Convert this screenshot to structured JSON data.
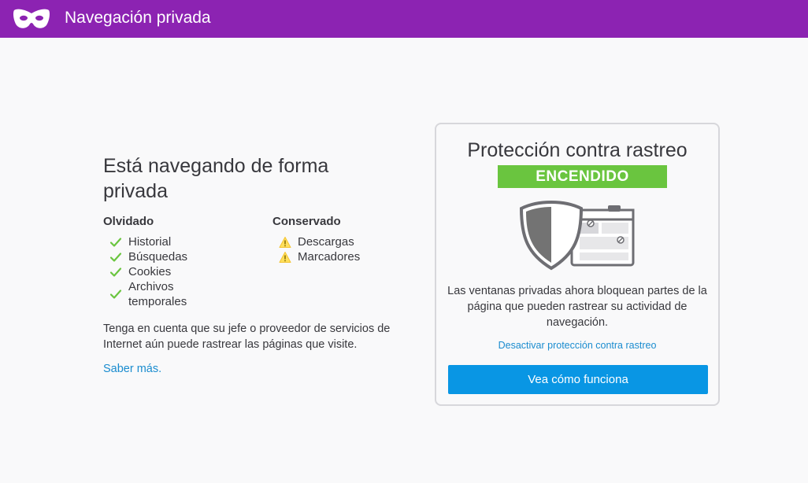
{
  "header": {
    "title": "Navegación privada",
    "icon": "private-mask-icon",
    "color": "#8c23b2"
  },
  "intro": {
    "heading": "Está navegando de forma privada",
    "forgotten": {
      "title": "Olvidado",
      "items": [
        "Historial",
        "Búsquedas",
        "Cookies",
        "Archivos temporales"
      ]
    },
    "kept": {
      "title": "Conservado",
      "items": [
        "Descargas",
        "Marcadores"
      ]
    },
    "note": "Tenga en cuenta que su jefe o proveedor de servicios de Internet aún puede rastrear las páginas que visite.",
    "learn_more": "Saber más."
  },
  "tracking": {
    "title": "Protección contra rastreo",
    "status": "ENCENDIDO",
    "status_color": "#6ac53f",
    "description": "Las ventanas privadas ahora bloquean partes de la página que pueden rastrear su actividad de navegación.",
    "disable_link": "Desactivar protección contra rastreo",
    "button": "Vea cómo funciona",
    "button_color": "#0996e4"
  }
}
